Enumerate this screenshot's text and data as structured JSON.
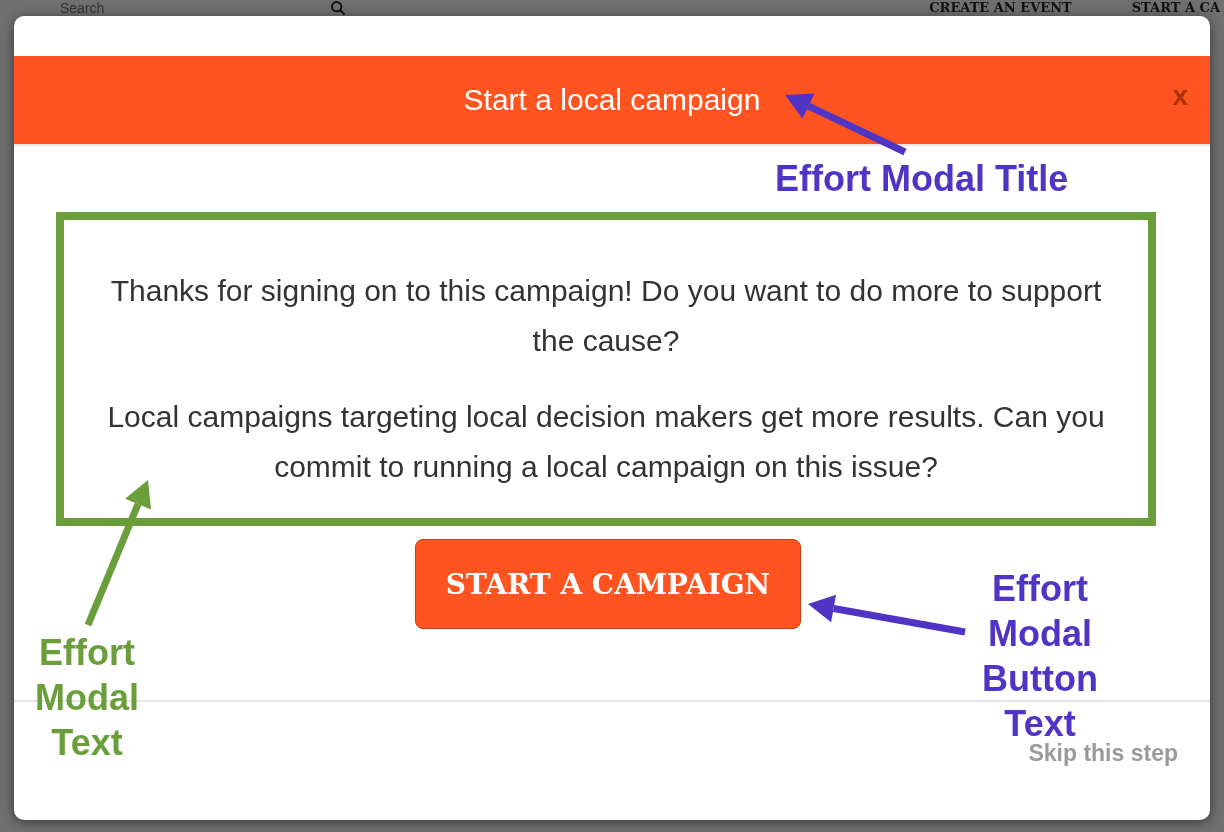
{
  "background_page": {
    "search_placeholder": "Search",
    "links": [
      "CREATE AN EVENT",
      "START A CA"
    ]
  },
  "modal": {
    "title": "Start a local campaign",
    "close": "x",
    "paragraphs": [
      "Thanks for signing on to this campaign! Do you want to do more to support the cause?",
      "Local campaigns targeting local decision makers get more results. Can you commit to running a local campaign on this issue?"
    ],
    "button": "START A CAMPAIGN",
    "skip": "Skip this step"
  },
  "annotations": [
    {
      "text": "Effort Modal Title",
      "color": "#5034c4"
    },
    {
      "text": "Effort Modal Text",
      "color": "#6a9e3a"
    },
    {
      "text": "Effort Modal Button Text",
      "color": "#5034c4"
    }
  ]
}
